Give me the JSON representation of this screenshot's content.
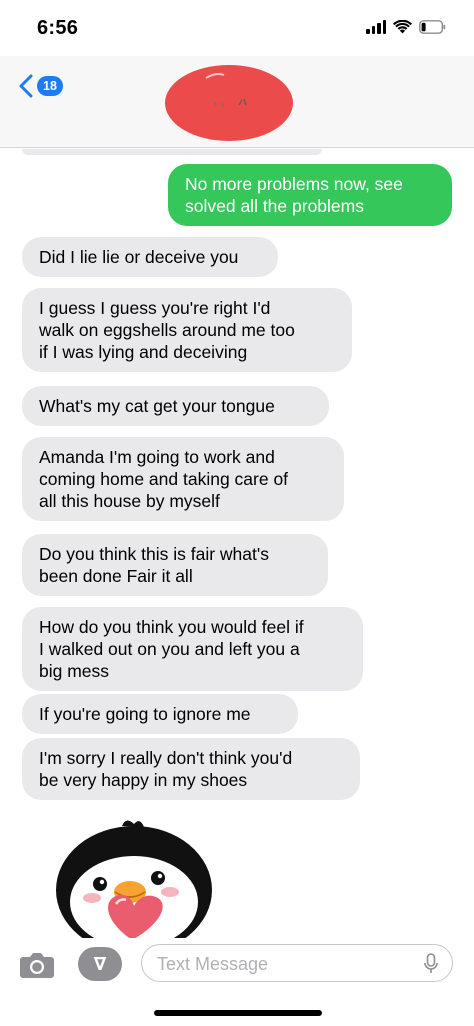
{
  "status_bar": {
    "time": "6:56",
    "signal_icon": "cellular-signal-icon",
    "wifi_icon": "wifi-icon",
    "battery_icon": "battery-low-icon"
  },
  "header": {
    "back_icon": "chevron-left-icon",
    "unread_count": "18",
    "avatar_color": "#ec4b4b"
  },
  "messages": [
    {
      "direction": "sent",
      "text": "No more problems now, see\nsolved all the problems"
    },
    {
      "direction": "received",
      "text": "Did I lie lie or deceive you"
    },
    {
      "direction": "received",
      "text": "I guess I guess you're right I'd\nwalk on eggshells around me too\nif I was lying and deceiving"
    },
    {
      "direction": "received",
      "text": "What's my cat get your tongue"
    },
    {
      "direction": "received",
      "text": "Amanda I'm going to work and\ncoming home and taking care of\nall this house by myself"
    },
    {
      "direction": "received",
      "text": "Do you think this is fair what's\nbeen done Fair it all"
    },
    {
      "direction": "received",
      "text": "How do you think you would feel if\nI walked out on you and left you a\nbig mess"
    },
    {
      "direction": "received",
      "text": "If you're going to ignore me"
    },
    {
      "direction": "received",
      "text": "I'm sorry I really don't think you'd\nbe very happy in my shoes"
    }
  ],
  "sticker": {
    "icon": "penguin-heart-sticker-icon"
  },
  "input_bar": {
    "camera_icon": "camera-icon",
    "apps_icon": "app-store-icon",
    "placeholder": "Text Message",
    "mic_icon": "microphone-icon"
  },
  "colors": {
    "sent_bubble": "#35c759",
    "received_bubble": "#e9e9eb",
    "accent": "#1b7cf5"
  }
}
